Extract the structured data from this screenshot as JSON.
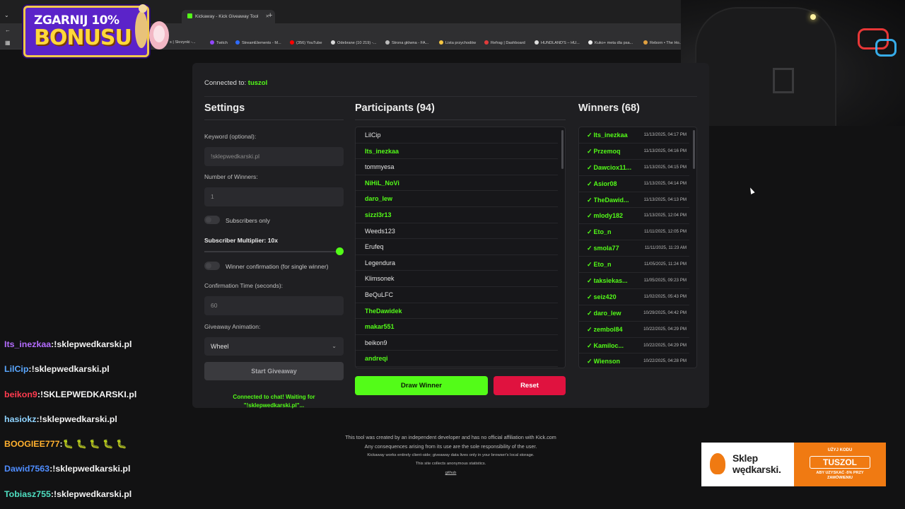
{
  "browser": {
    "tabs": [
      {
        "label": "Kickaway - Kick Giveaway Tool",
        "active": true
      },
      {
        "label": "+"
      }
    ],
    "bookmarks": [
      "s | Skrzynki -...",
      "Twitch",
      "StreamElements - M...",
      "(356) YouTube",
      "Odebrane (10 219) -...",
      "Strona główna - FA...",
      "Lista przychodów",
      "Refrag | Dashboard",
      "HUNDLAND'S – HU...",
      "Kuko+ meta dla psa...",
      "Reborn • The Ho..."
    ]
  },
  "promo": {
    "line1": "ZGARNIJ 10%",
    "line2": "BONUSU"
  },
  "connection": {
    "prefix": "Connected to:",
    "channel": "tuszol"
  },
  "settings": {
    "title": "Settings",
    "keyword_label": "Keyword (optional):",
    "keyword_value": "!sklepwedkarski.pl",
    "winners_label": "Number of Winners:",
    "winners_value": "1",
    "subs_only_label": "Subscribers only",
    "multiplier_label": "Subscriber Multiplier: 10x",
    "confirm_label": "Winner confirmation (for single winner)",
    "confirm_time_label": "Confirmation Time (seconds):",
    "confirm_time_value": "60",
    "animation_label": "Giveaway Animation:",
    "animation_value": "Wheel",
    "start_label": "Start Giveaway",
    "status_text": "Connected to chat! Waiting for \"!sklepwedkarski.pl\"..."
  },
  "participants": {
    "title": "Participants (94)",
    "items": [
      {
        "name": "LilCip",
        "winner": false
      },
      {
        "name": "Its_inezkaa",
        "winner": true
      },
      {
        "name": "tommyesa",
        "winner": false
      },
      {
        "name": "NiHiL_NoVi",
        "winner": true
      },
      {
        "name": "daro_lew",
        "winner": true
      },
      {
        "name": "sizzl3r13",
        "winner": true
      },
      {
        "name": "Weeds123",
        "winner": false
      },
      {
        "name": "Erufeq",
        "winner": false
      },
      {
        "name": "Legendura",
        "winner": false
      },
      {
        "name": "Klimsonek",
        "winner": false
      },
      {
        "name": "BeQuLFC",
        "winner": false
      },
      {
        "name": "TheDawidek",
        "winner": true
      },
      {
        "name": "makar551",
        "winner": true
      },
      {
        "name": "beikon9",
        "winner": false
      },
      {
        "name": "andreqi",
        "winner": true
      }
    ],
    "draw_label": "Draw Winner",
    "reset_label": "Reset"
  },
  "winners": {
    "title": "Winners (68)",
    "items": [
      {
        "name": "Its_inezkaa",
        "time": "11/13/2025, 04:17 PM"
      },
      {
        "name": "Przemoq",
        "time": "11/13/2025, 04:16 PM"
      },
      {
        "name": "Dawciox11...",
        "time": "11/13/2025, 04:15 PM"
      },
      {
        "name": "Asior08",
        "time": "11/13/2025, 04:14 PM"
      },
      {
        "name": "TheDawid...",
        "time": "11/13/2025, 04:13 PM"
      },
      {
        "name": "mlody182",
        "time": "11/13/2025, 12:04 PM"
      },
      {
        "name": "Eto_n",
        "time": "11/11/2025, 12:05 PM"
      },
      {
        "name": "smola77",
        "time": "11/11/2025, 11:23 AM"
      },
      {
        "name": "Eto_n",
        "time": "11/05/2025, 11:24 PM"
      },
      {
        "name": "taksiekas...",
        "time": "11/05/2025, 09:23 PM"
      },
      {
        "name": "seiz420",
        "time": "11/02/2025, 05:43 PM"
      },
      {
        "name": "daro_lew",
        "time": "10/29/2025, 04:42 PM"
      },
      {
        "name": "zembol84",
        "time": "10/22/2025, 04:29 PM"
      },
      {
        "name": "Kamiloc...",
        "time": "10/22/2025, 04:29 PM"
      },
      {
        "name": "Wienson",
        "time": "10/22/2025, 04:28 PM"
      }
    ]
  },
  "footer": {
    "line1": "This tool was created by an independent developer and has no official affiliation with Kick.com",
    "line2": "Any consequences arising from its use are the sole responsibility of the user.",
    "line3": "Kickaway works entirely client-side; giveaway data lives only in your browser's local storage.",
    "line4": "This site collects anonymous statistics.",
    "line5": "github"
  },
  "chat": [
    {
      "user": "Its_inezkaa",
      "sep": ":",
      "text": "!sklepwedkarski.pl",
      "color": "#b46cff"
    },
    {
      "user": "LilCip",
      "sep": ":",
      "text": "!sklepwedkarski.pl",
      "color": "#5aa7ff"
    },
    {
      "user": "beikon9",
      "sep": ":",
      "text": "!SKLEPWEDKARSKI.pl",
      "color": "#ff3b4f"
    },
    {
      "user": "hasiokz",
      "sep": ":",
      "text": "!sklepwedkarski.pl",
      "color": "#8fd3ff"
    },
    {
      "user": "BOOGIEE777",
      "sep": ":",
      "text": "🐛 🐛 🐛 🐛 🐛",
      "color": "#ffb02e"
    },
    {
      "user": "Dawid7563",
      "sep": ":",
      "text": "!sklepwedkarski.pl",
      "color": "#4f8dff"
    },
    {
      "user": "Tobiasz755",
      "sep": ":",
      "text": "!sklepwedkarski.pl",
      "color": "#4fe0c2"
    }
  ],
  "sponsor": {
    "name1": "Sklep",
    "name2": "wędkarski.",
    "code_label": "UŻYJ KODU",
    "code": "TUSZOL",
    "note": "ABY UZYSKAĆ -5% PRZY ZAMÓWIENIU"
  },
  "colors": {
    "accent": "#53fc18",
    "danger": "#e0123f",
    "card": "#1f1f22"
  }
}
